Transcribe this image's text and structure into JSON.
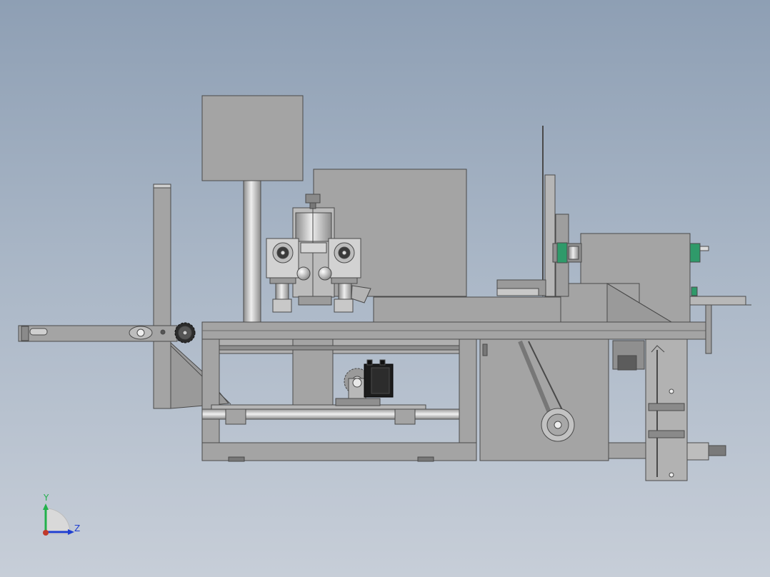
{
  "view": {
    "background_top": "#8e9fb4",
    "background_bottom": "#c7ced8",
    "part_fill": "#a4a4a4",
    "part_stroke": "#4a4a4a",
    "accent_green": "#2f9a6a"
  },
  "triad": {
    "y_label": "Y",
    "z_label": "Z",
    "y_axis_color": "#22b14c",
    "z_axis_color": "#1f3fd1",
    "origin_color": "#c0392b"
  }
}
